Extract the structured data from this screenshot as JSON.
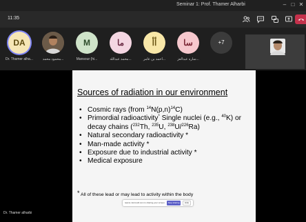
{
  "window": {
    "title": "Seminar 1: Prof. Thamer Alharbi"
  },
  "toolbar": {
    "timer": "11:35"
  },
  "participants": [
    {
      "initials": "DA",
      "name": "Dr. Thamer alha...",
      "bg": "#f6e6b6",
      "fg": "#5c4a10",
      "speaking": true
    },
    {
      "initials": "",
      "name": "محمود محمد...",
      "bg": "#5b4a3a",
      "fg": "#fff",
      "photo": true
    },
    {
      "initials": "M",
      "name": "Mansour (hi...",
      "bg": "#cfe3c9",
      "fg": "#2d4a2a"
    },
    {
      "initials": "ما",
      "name": "محمد عبدالله...",
      "bg": "#f4d6e2",
      "fg": "#6a2a44"
    },
    {
      "initials": "أأ",
      "name": "أحمد بن عامر...",
      "bg": "#f8e7a8",
      "fg": "#6a5414"
    },
    {
      "initials": "سا",
      "name": "ساره عبدالعز...",
      "bg": "#f6c8cd",
      "fg": "#7a2634"
    }
  ],
  "overflow": {
    "label": "+7"
  },
  "slide": {
    "title": "Sources of radiation in our environment",
    "bullets": {
      "cosmic": {
        "pre": "Cosmic rays (from ",
        "s1": "14",
        "mid": "N(p,n)",
        "s2": "14",
        "post": "C)"
      },
      "primordial": {
        "pre": "Primordial radioactivity",
        "ast": "*",
        "a": " Single nuclei (e.g., ",
        "s1": "40",
        "b": "K) or decay chains (",
        "s2": "232",
        "c": "Th, ",
        "s3": "235",
        "d": "U, ",
        "s4": "238",
        "e": "U/",
        "s5": "226",
        "f": "Ra)"
      },
      "natural": "Natural secondary radioactivity *",
      "manmade": "Man-made activity *",
      "industrial": "Exposure due to industrial activity *",
      "medical": "Medical exposure"
    },
    "footnote": {
      "ast": "*",
      "text": " All of these lead or may lead to activity within the body"
    }
  },
  "share_bar": {
    "message": "teams.microsoft.com is sharing your screen.",
    "stop_label": "Stop sharing",
    "hide_label": "Hide"
  },
  "presenter": {
    "name": "Dr. Thamer alharbi"
  }
}
